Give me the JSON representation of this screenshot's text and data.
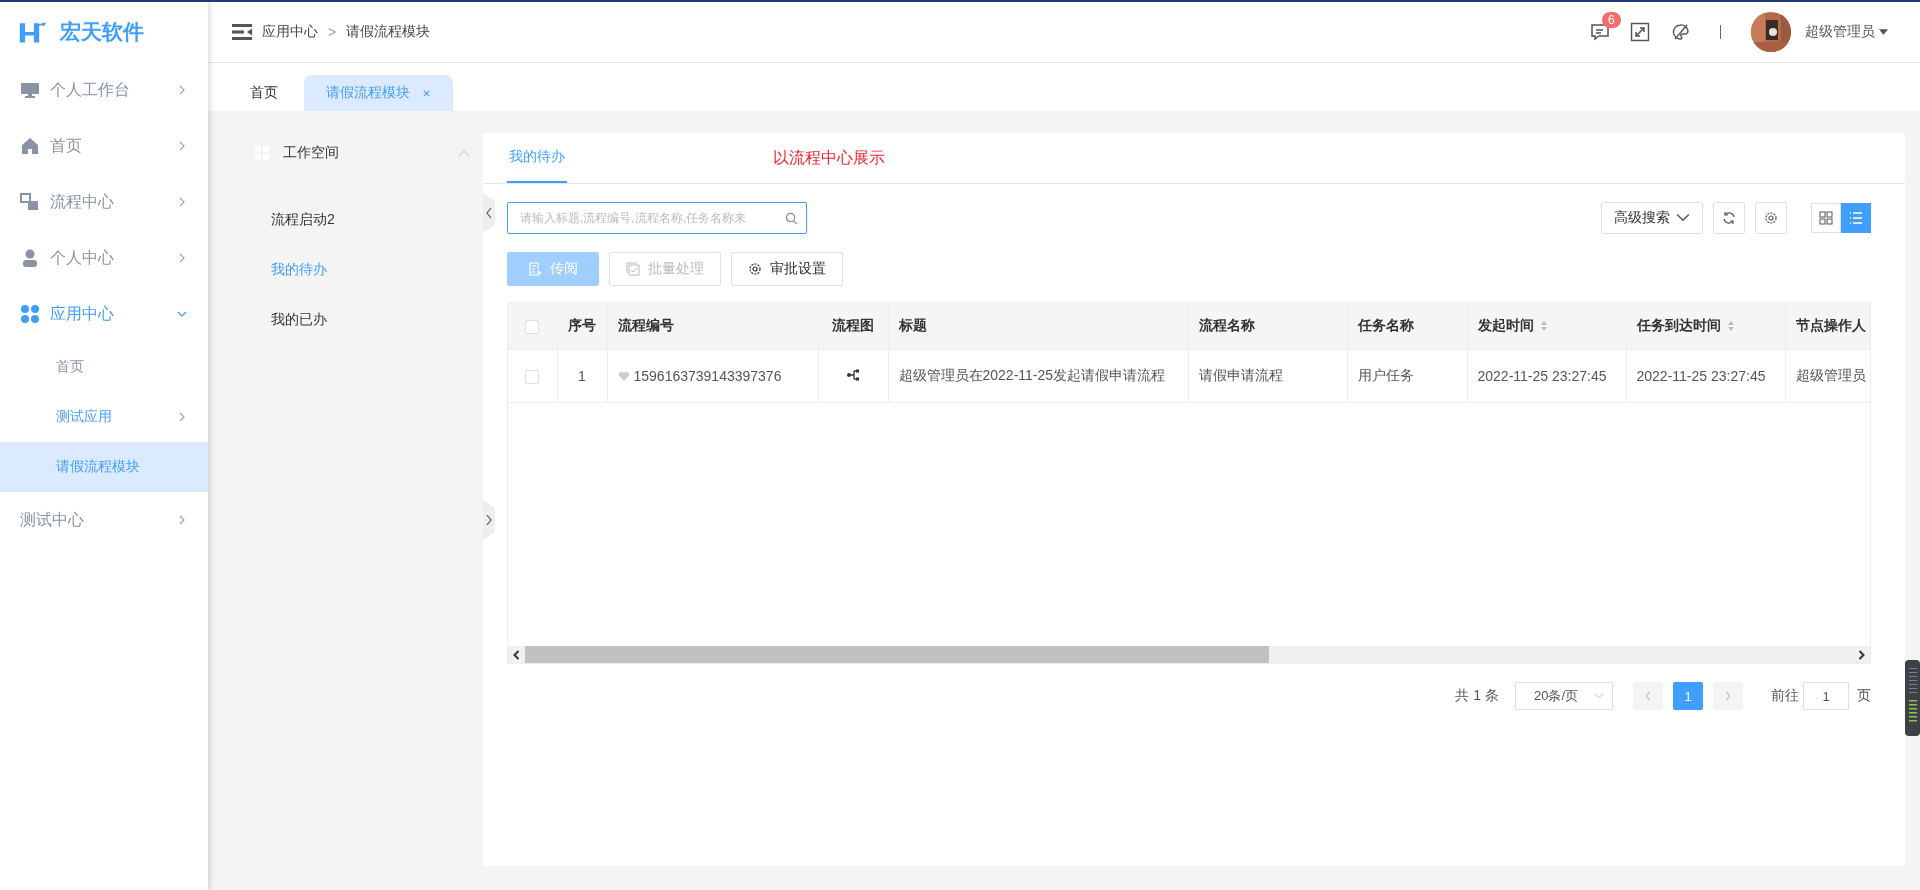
{
  "logo": {
    "text": "宏天软件"
  },
  "sidebar": {
    "items": [
      {
        "label": "个人工作台",
        "active": false,
        "expanded": false
      },
      {
        "label": "首页",
        "active": false,
        "expanded": false
      },
      {
        "label": "流程中心",
        "active": false,
        "expanded": false
      },
      {
        "label": "个人中心",
        "active": false,
        "expanded": false
      },
      {
        "label": "应用中心",
        "active": true,
        "expanded": true,
        "children": [
          {
            "label": "首页",
            "active": false,
            "selected": false
          },
          {
            "label": "测试应用",
            "active": true,
            "selected": false,
            "expanded": false
          },
          {
            "label": "请假流程模块",
            "active": true,
            "selected": true
          }
        ]
      },
      {
        "label": "测试中心",
        "active": false,
        "expanded": false
      }
    ]
  },
  "header": {
    "breadcrumb": [
      "应用中心",
      "请假流程模块"
    ],
    "separator": ">",
    "notification_count": "6",
    "user": "超级管理员"
  },
  "page_tabs": [
    {
      "label": "首页",
      "selected": false
    },
    {
      "label": "请假流程模块",
      "selected": true
    }
  ],
  "workspace": {
    "title": "工作空间",
    "expanded": true,
    "items": [
      {
        "label": "流程启动2",
        "selected": false
      },
      {
        "label": "我的待办",
        "selected": true
      },
      {
        "label": "我的已办",
        "selected": false
      }
    ]
  },
  "card": {
    "tabs": [
      {
        "label": "我的待办",
        "selected": true
      }
    ],
    "note": "以流程中心展示",
    "search": {
      "placeholder": "请输入标题,流程编号,流程名称,任务名称来"
    },
    "advanced_search": "高级搜索",
    "view_modes": [
      {
        "selected": false
      },
      {
        "selected": true
      }
    ],
    "actions": [
      {
        "label": "传阅",
        "kind": "primary",
        "disabled": true
      },
      {
        "label": "批量处理",
        "kind": "batch",
        "disabled": true
      },
      {
        "label": "审批设置",
        "kind": "settings",
        "disabled": false
      }
    ],
    "table": {
      "columns": [
        {
          "label": "序号",
          "sortable": false
        },
        {
          "label": "流程编号",
          "sortable": false
        },
        {
          "label": "流程图",
          "sortable": false
        },
        {
          "label": "标题",
          "sortable": false
        },
        {
          "label": "流程名称",
          "sortable": false
        },
        {
          "label": "任务名称",
          "sortable": false
        },
        {
          "label": "发起时间",
          "sortable": true
        },
        {
          "label": "任务到达时间",
          "sortable": true
        },
        {
          "label": "节点操作人"
        }
      ],
      "all_checked": false,
      "rows": [
        {
          "checked": false,
          "favorite": false,
          "index": "1",
          "code": "1596163739143397376",
          "title": "超级管理员在2022-11-25发起请假申请流程",
          "process_name": "请假申请流程",
          "task_name": "用户任务",
          "start_time": "2022-11-25 23:27:45",
          "arrive_time": "2022-11-25 23:27:45",
          "operator": "超级管理员"
        }
      ]
    },
    "pagination": {
      "total": "共 1 条",
      "page_size": "20条/页",
      "pages": [
        {
          "label": "1",
          "selected": true
        }
      ],
      "goto_label": "前往",
      "goto_value": "1",
      "page_unit": "页"
    }
  }
}
